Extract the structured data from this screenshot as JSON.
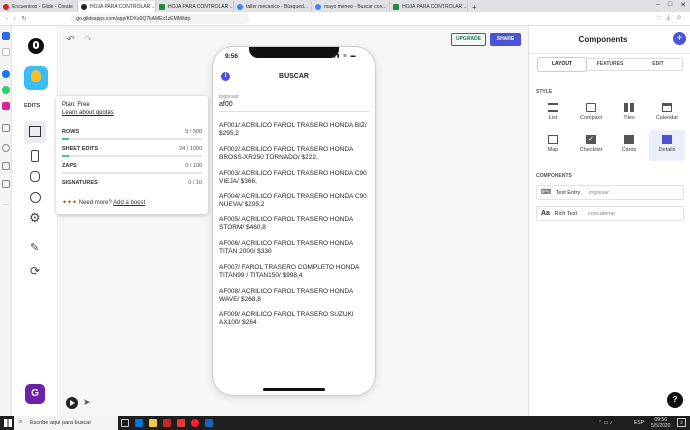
{
  "browser": {
    "tabs": [
      {
        "label": "Encuentros - Glide - Create"
      },
      {
        "label": "HOJA PARA CONTROLAR ..."
      },
      {
        "label": "HOJA PARA CONTROLAR ..."
      },
      {
        "label": "taller mecanico - Búsqued..."
      },
      {
        "label": "mayo meneo - Buscar con..."
      },
      {
        "label": "HOJA PARA CONTROLAR ..."
      }
    ],
    "url": "go.glideapps.com/app/KDXa9Q7kAMEx1zEMM/tdp"
  },
  "toolbar": {
    "upgrade_label": "UPGRADE",
    "share_label": "SHARE"
  },
  "rail": {
    "edits_label": "EDITS",
    "user_initial": "G"
  },
  "plan": {
    "title_prefix": "Plan:",
    "title_value": "Free",
    "learn_link": "Learn about quotas",
    "rows": [
      {
        "label": "ROWS",
        "value": "9 / 500",
        "fraction": 0.018
      },
      {
        "label": "SHEET EDITS",
        "value": "24 / 1000",
        "fraction": 0.024
      },
      {
        "label": "ZAPS",
        "value": "0 / 100",
        "fraction": 0
      },
      {
        "label": "SIGNATURES",
        "value": "0 / 10",
        "fraction": 0
      }
    ],
    "need_more": "Need more?",
    "boost_link": "Add a boost"
  },
  "phone": {
    "time": "9:56",
    "title": "BUSCAR",
    "search_placeholder": "ingresar",
    "search_value": "af00",
    "items": [
      "AF001/ ACRILICO FAROL TRASERO HONDA BIZ/ $295,2",
      "AF002/ ACRILICO FAROL TRASERO HONDA BROSS-XR250 TORNADO/ $222,",
      "AF003/ ACRILICO FAROL TRASERO HONDA C90 VIEJA/ $366,",
      "AF004/ ACRILICO FAROL TRASERO HONDA C90 NUEVA/ $295,2",
      "AF005/ ACRILICO FAROL TRASERO HONDA STORM/ $460,8",
      "AF006/ ACRILICO FAROL TRASERO HONDA TITAN 2000/ $330",
      "AF007/ FAROL TRASERO COMPLETO HONDA TITAN99 / TITAN150/ $998,4",
      "AF008/ ACRILICO FAROL TRASERO HONDA WAVE/ $268,8",
      "AF009/ ACRILICO FAROL TRASERO SUZUKI AX100/ $264"
    ]
  },
  "panel": {
    "title": "Components",
    "tabs": [
      "LAYOUT",
      "FEATURES",
      "EDIT"
    ],
    "style_header": "STYLE",
    "styles": [
      "List",
      "Compact",
      "Tiles",
      "Calendar",
      "Map",
      "Checklist",
      "Cards",
      "Details"
    ],
    "components_header": "COMPONENTS",
    "components": [
      {
        "label": "Text Entry",
        "sub": "ingresar"
      },
      {
        "label": "Rich Text",
        "sub": "concatenar"
      }
    ]
  },
  "taskbar": {
    "search_placeholder": "Escribe aquí para buscar",
    "lang": "ESP",
    "time": "09:56",
    "date": "5/5/2020",
    "notif_count": "2"
  },
  "colors": {
    "accent": "#4a52d6",
    "upgrade_green": "#1d7a55",
    "progress": "#46c2a8",
    "app_icon": "#fbbf24",
    "avatar": "#6b21a8"
  }
}
